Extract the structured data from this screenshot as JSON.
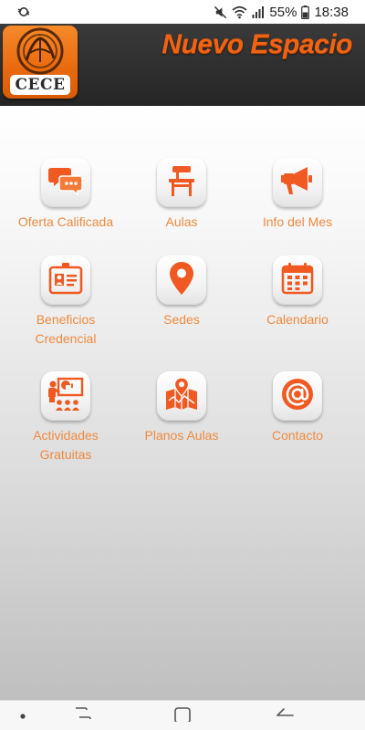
{
  "status_bar": {
    "battery_percent": "55%",
    "time": "18:38"
  },
  "header": {
    "logo_text": "CECE",
    "title": "Nuevo Espacio"
  },
  "colors": {
    "accent": "#f16312",
    "label": "#ef8a3f"
  },
  "menu": [
    {
      "label": "Oferta Calificada",
      "icon": "chat-bubbles-icon"
    },
    {
      "label": "Aulas",
      "icon": "school-desk-icon"
    },
    {
      "label": "Info del Mes",
      "icon": "megaphone-icon"
    },
    {
      "label": "Beneficios Credencial",
      "icon": "id-card-icon"
    },
    {
      "label": "Sedes",
      "icon": "map-pin-icon"
    },
    {
      "label": "Calendario",
      "icon": "calendar-icon"
    },
    {
      "label": "Actividades Gratuitas",
      "icon": "presentation-board-icon"
    },
    {
      "label": "Planos Aulas",
      "icon": "folded-map-icon"
    },
    {
      "label": "Contacto",
      "icon": "at-sign-icon"
    }
  ]
}
